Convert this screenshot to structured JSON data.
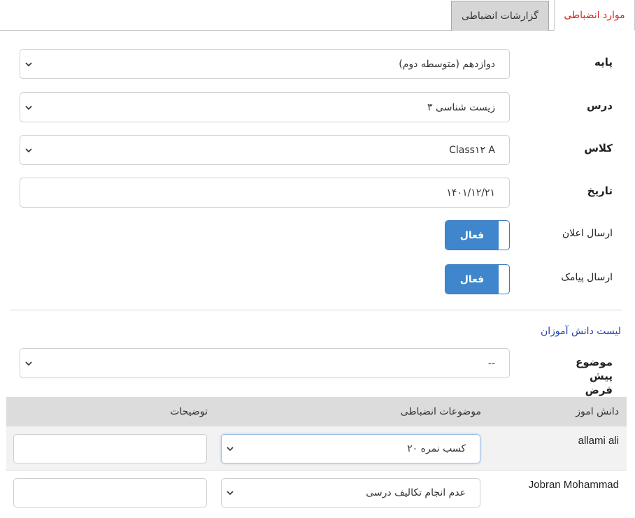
{
  "tabs": {
    "active": "موارد انضباطی",
    "inactive": "گزارشات انضباطی"
  },
  "form": {
    "grade": {
      "label": "پایه",
      "value": "دوازدهم (متوسطه دوم)"
    },
    "course": {
      "label": "درس",
      "value": "زیست شناسی ۳"
    },
    "class": {
      "label": "کلاس",
      "value": "Class۱۲ A"
    },
    "date": {
      "label": "تاریخ",
      "value": "۱۴۰۱/۱۲/۲۱"
    },
    "send_notification": {
      "label": "ارسال اعلان",
      "state": "فعال"
    },
    "send_sms": {
      "label": "ارسال پیامک",
      "state": "فعال"
    }
  },
  "students_section": {
    "title": "لیست دانش آموزان",
    "default_topic": {
      "label": "موضوع پیش فرض",
      "value": "--"
    }
  },
  "table": {
    "headers": {
      "student": "دانش اموز",
      "topics": "موضوعات انضباطی",
      "notes": "توضیحات"
    },
    "rows": [
      {
        "student": "allami ali",
        "topic": "کسب نمره ۲۰",
        "notes": ""
      },
      {
        "student": "Jobran Mohammad",
        "topic": "عدم انجام تکالیف درسی",
        "notes": ""
      }
    ]
  },
  "colors": {
    "accent": "#3f86cc",
    "active_tab": "#d9241b",
    "link": "#1f3fae"
  }
}
